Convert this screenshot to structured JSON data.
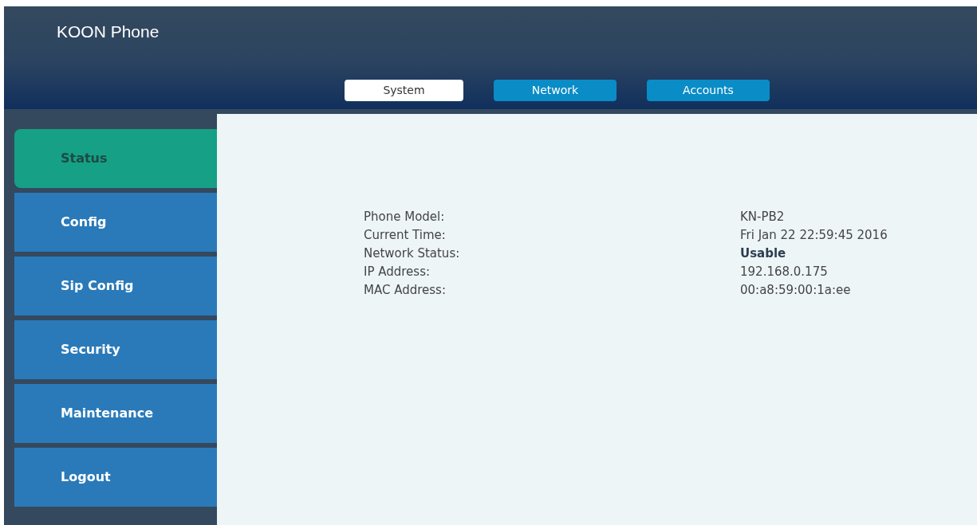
{
  "header": {
    "title": "KOON Phone"
  },
  "tabs": [
    {
      "label": "System",
      "selected": true
    },
    {
      "label": "Network",
      "selected": false
    },
    {
      "label": "Accounts",
      "selected": false
    }
  ],
  "sidebar": {
    "items": [
      {
        "label": "Status",
        "selected": true
      },
      {
        "label": "Config",
        "selected": false
      },
      {
        "label": "Sip Config",
        "selected": false
      },
      {
        "label": "Security",
        "selected": false
      },
      {
        "label": "Maintenance",
        "selected": false
      },
      {
        "label": "Logout",
        "selected": false
      }
    ]
  },
  "status": [
    {
      "label": "Phone Model:",
      "value": "KN-PB2",
      "bold": false
    },
    {
      "label": "Current Time:",
      "value": "Fri Jan 22 22:59:45 2016",
      "bold": false
    },
    {
      "label": "Network Status:",
      "value": "Usable",
      "bold": true
    },
    {
      "label": "IP Address:",
      "value": "192.168.0.175",
      "bold": false
    },
    {
      "label": "MAC Address:",
      "value": "00:a8:59:00:1a:ee",
      "bold": false
    }
  ]
}
